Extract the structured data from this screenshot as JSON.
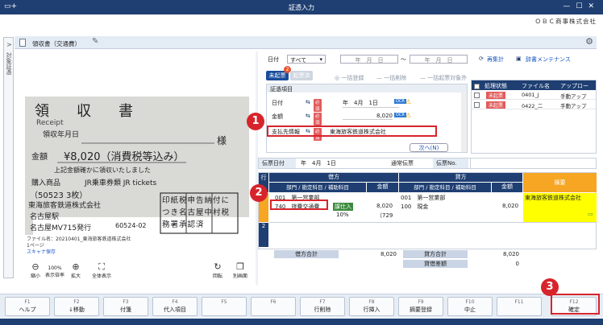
{
  "window": {
    "title": "証憑入力",
    "company": "ＯＢＣ商事株式会社",
    "side_tab": "対象証憑"
  },
  "doc": {
    "title": "領収書（交通費）"
  },
  "receipt": {
    "lines": [
      "領　収　書",
      "Receipt",
      "領収年月日",
      "¥8,020（消費税等込み）",
      "金額",
      "上記金額確かに領収いたしました",
      "購入商品",
      "JR乗車券類 JR tickets",
      "（50523 3枚）",
      "東海旅客鉄道株式会社",
      "名古屋駅",
      "名古屋MV715発行",
      "60524-02",
      "様",
      "印紙税申告納付につき名古屋中村税務署承認済"
    ]
  },
  "image_footer": {
    "file_name": "ファイル名：20210401_東海旅客鉄道株式会社",
    "page": "1ページ",
    "scan_link": "スキャナ保存"
  },
  "image_tools": [
    {
      "label": "縮小",
      "icon": "zoom-out-icon"
    },
    {
      "label": "表示倍率",
      "value": "100%"
    },
    {
      "label": "拡大",
      "icon": "zoom-in-icon"
    },
    {
      "label": "全体表示",
      "icon": "fit-icon"
    },
    {
      "label": "回転",
      "icon": "rotate-icon"
    },
    {
      "label": "別画面",
      "icon": "window-icon"
    }
  ],
  "filter": {
    "date_label": "日付",
    "date_select": "すべて",
    "from_placeholder": "年　月　日",
    "to_placeholder": "年　月　日",
    "tilde": "～",
    "recalc": "再集計",
    "dictionary": "辞書メンテナンス"
  },
  "tabs": {
    "unrecorded": "未起票",
    "recorded": "起票済",
    "badge": "2"
  },
  "actions": {
    "bulk_register": "一括登録",
    "bulk_delete": "一括削除",
    "bulk_exclude": "一括起票対象外"
  },
  "form": {
    "header": "証憑項目",
    "date_label": "日付",
    "date_value": "年　4月　1日",
    "amount_label": "金額",
    "amount_value": "8,020",
    "payee_label": "支払先情報",
    "payee_value": "東海旅客鉄道株式会社",
    "required": "必須",
    "ocr": "OCR",
    "next_button": "次へ(N)"
  },
  "doc_list": {
    "headers": [
      "処理状態",
      "ファイル名",
      "アップロー"
    ],
    "rows": [
      {
        "status": "未起票",
        "file": "0401_J",
        "upload": "手動アップ"
      },
      {
        "status": "未起票",
        "file": "0422_二",
        "upload": "手動アップ"
      }
    ]
  },
  "voucher": {
    "date_label": "伝票日付",
    "date_value": "年　4月　1日",
    "type": "通常伝票",
    "no_label": "伝票No."
  },
  "grid": {
    "row_header": "行",
    "debit_header": "借方",
    "credit_header": "貸方",
    "summary_header": "摘要",
    "sub_dept": "部門 / 勘定科目 / 補助科目",
    "sub_amount": "金額",
    "row1": {
      "no": "1",
      "debit_dept": "001　第一営業部",
      "debit_account": "740　旅費交通費",
      "debit_tax": "課仕入",
      "debit_rate": "10%",
      "debit_amount": "8,020",
      "debit_tax_amount": "（729",
      "credit_dept": "001　第一営業部",
      "credit_account": "100　現金",
      "credit_amount": "8,020",
      "summary": "東海旅客鉄道株式会社"
    },
    "row2": {
      "no": "2"
    }
  },
  "totals": {
    "debit_label": "借方合計",
    "debit_value": "8,020",
    "credit_label": "貸方合計",
    "credit_value": "8,020",
    "diff_label": "貸借差額",
    "diff_value": "0"
  },
  "fkeys": [
    {
      "key": "F1",
      "label": "ヘルプ"
    },
    {
      "key": "F2",
      "label": "↓移動"
    },
    {
      "key": "F3",
      "label": "付箋"
    },
    {
      "key": "F4",
      "label": "代入項目"
    },
    {
      "key": "F5",
      "label": ""
    },
    {
      "key": "F6",
      "label": ""
    },
    {
      "key": "F7",
      "label": "行削除"
    },
    {
      "key": "F8",
      "label": "行挿入"
    },
    {
      "key": "F9",
      "label": "摘要登録"
    },
    {
      "key": "F10",
      "label": "中止"
    },
    {
      "key": "F11",
      "label": ""
    },
    {
      "key": "F12",
      "label": "確定"
    }
  ],
  "callouts": [
    "1",
    "2",
    "3"
  ],
  "colors": {
    "titlebar": "#1f3f73",
    "accent_red": "#d7242b",
    "summary_yellow": "#ffff00"
  }
}
